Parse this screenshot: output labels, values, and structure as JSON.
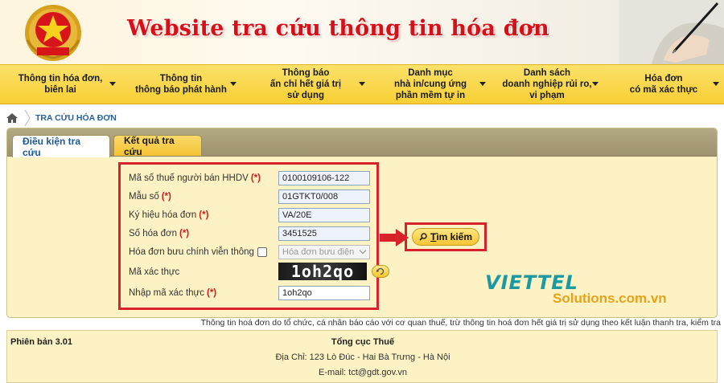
{
  "header": {
    "title": "Website tra cứu thông tin hóa đơn",
    "emblem_text": "THUẾ NHÀ NƯỚC",
    "brand_red": "#d6101a"
  },
  "nav": {
    "items": [
      {
        "label": "Thông tin hóa đơn,\nbiên lai"
      },
      {
        "label": "Thông tin\nthông báo phát hành"
      },
      {
        "label": "Thông báo\nấn chỉ hết giá trị\nsử dụng"
      },
      {
        "label": "Danh mục\nnhà in/cung ứng\nphần mềm tự in"
      },
      {
        "label": "Danh sách\ndoanh nghiệp rủi ro,\nvi phạm"
      },
      {
        "label": "Hóa đơn\ncó mã xác thực"
      }
    ]
  },
  "breadcrumb": {
    "current": "TRA CỨU HÓA ĐƠN"
  },
  "tabs": {
    "active": "Điều kiện tra cứu",
    "inactive": "Kết quả tra cứu"
  },
  "form": {
    "required_mark": "(*)",
    "mst_label": "Mã số thuế người bán HHDV",
    "mst_value": "0100109106-122",
    "mau_so_label": "Mẫu số",
    "mau_so_value": "01GTKT0/008",
    "ky_hieu_label": "Ký hiệu hóa đơn",
    "ky_hieu_value": "VA/20E",
    "so_hd_label": "Số hóa đơn",
    "so_hd_value": "3451525",
    "buu_chinh_label": "Hóa đơn bưu chính viễn thông",
    "buu_chinh_select": "Hóa đơn bưu điện",
    "captcha_label": "Mã xác thực",
    "captcha_image_text": "1oh2qo",
    "captcha_input_label": "Nhập mã xác thực",
    "captcha_input_value": "1oh2qo"
  },
  "search": {
    "label": "Tìm kiếm",
    "underline_char": "T",
    "rest": "ìm kiếm"
  },
  "partner": {
    "word": "VIETTEL",
    "sub": "Solutions.com.vn"
  },
  "notice": "Thông tin hoá đơn do tổ chức, cá nhân báo cáo với cơ quan thuế, trừ thông tin hoá đơn hết giá trị sử dụng theo kết luận thanh tra, kiểm tra",
  "footer": {
    "version": "Phiên bản 3.01",
    "org": "Tổng cục Thuế",
    "address": "Địa Chỉ: 123 Lò Đúc - Hai Bà Trưng - Hà Nội",
    "email": "E-mail: tct@gdt.gov.vn"
  }
}
